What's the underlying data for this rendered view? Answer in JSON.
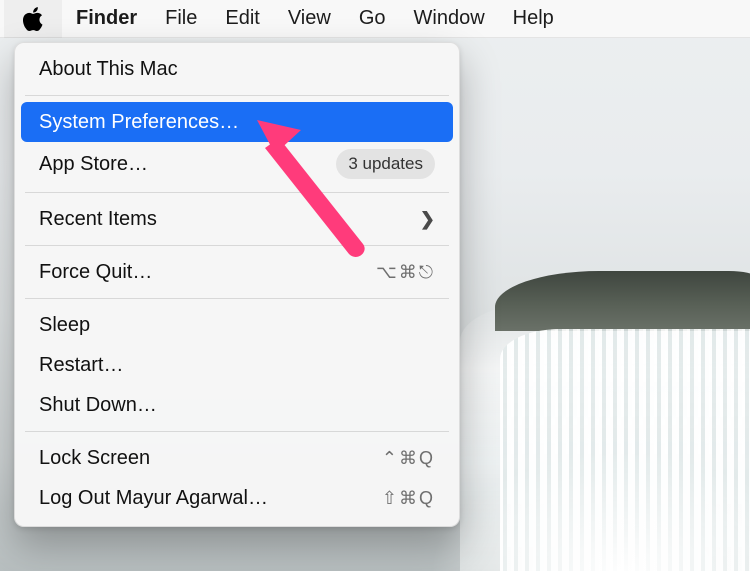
{
  "menubar": {
    "items": [
      "Finder",
      "File",
      "Edit",
      "View",
      "Go",
      "Window",
      "Help"
    ],
    "active_index": 0
  },
  "apple_menu": {
    "about": "About This Mac",
    "system_preferences": "System Preferences…",
    "app_store": {
      "label": "App Store…",
      "badge": "3 updates"
    },
    "recent_items": "Recent Items",
    "force_quit": {
      "label": "Force Quit…",
      "shortcut": "⌥⌘⎋"
    },
    "sleep": "Sleep",
    "restart": "Restart…",
    "shut_down": "Shut Down…",
    "lock_screen": {
      "label": "Lock Screen",
      "shortcut": "⌃⌘Q"
    },
    "log_out": {
      "label": "Log Out Mayur Agarwal…",
      "shortcut": "⇧⌘Q"
    }
  },
  "annotation": {
    "color": "#ff3b7b"
  }
}
